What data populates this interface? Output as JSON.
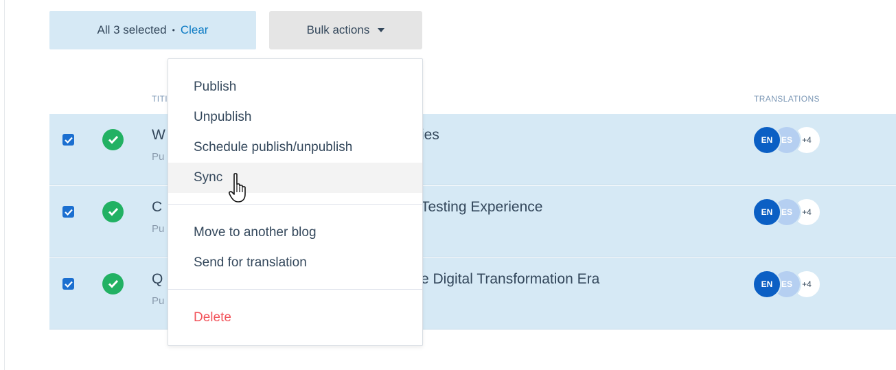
{
  "selection": {
    "summary": "All 3 selected",
    "separator": "•",
    "clear_label": "Clear"
  },
  "bulk_actions": {
    "label": "Bulk actions",
    "menu": {
      "publish": "Publish",
      "unpublish": "Unpublish",
      "schedule": "Schedule publish/unpublish",
      "sync": "Sync",
      "move": "Move to another blog",
      "translate": "Send for translation",
      "delete": "Delete"
    },
    "hovered_item": "Sync"
  },
  "table": {
    "headers": {
      "title": "TITI",
      "translations": "TRANSLATIONS"
    },
    "rows": [
      {
        "checked": true,
        "status_icon": "check-circle-icon",
        "title_start": "W",
        "title_end": "ies",
        "subtitle": "Pu",
        "translations": {
          "primary": "EN",
          "secondary": "ES",
          "more": "+4"
        }
      },
      {
        "checked": true,
        "status_icon": "check-circle-icon",
        "title_start": "C",
        "title_end": "Testing Experience",
        "subtitle": "Pu",
        "translations": {
          "primary": "EN",
          "secondary": "ES",
          "more": "+4"
        }
      },
      {
        "checked": true,
        "status_icon": "check-circle-icon",
        "title_start": "Q",
        "title_end": "e Digital Transformation Era",
        "subtitle": "Pu",
        "translations": {
          "primary": "EN",
          "secondary": "ES",
          "more": "+4"
        }
      }
    ]
  },
  "colors": {
    "selected_row": "#d6e9f5",
    "link": "#0d7bc4",
    "published": "#22b163",
    "danger": "#f2545b",
    "checkbox": "#1b6fd0"
  }
}
